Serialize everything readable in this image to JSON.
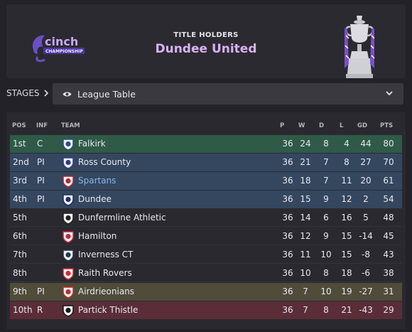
{
  "header": {
    "competition_logo_text": "cinch",
    "competition_logo_sub": "CHAMPIONSHIP",
    "holders_label": "TITLE HOLDERS",
    "holders_name": "Dundee United"
  },
  "stages": {
    "label": "STAGES",
    "selected": "League Table"
  },
  "table": {
    "columns": [
      "POS",
      "INF",
      "TEAM",
      "P",
      "W",
      "D",
      "L",
      "GD",
      "PTS"
    ],
    "rows": [
      {
        "pos": "1st",
        "inf": "C",
        "team": "Falkirk",
        "p": "36",
        "w": "24",
        "d": "8",
        "l": "4",
        "gd": "44",
        "pts": "80",
        "zone": "pro",
        "badge_color": "#2c4f8a"
      },
      {
        "pos": "2nd",
        "inf": "PI",
        "team": "Ross County",
        "p": "36",
        "w": "21",
        "d": "7",
        "l": "8",
        "gd": "27",
        "pts": "70",
        "zone": "playoff",
        "badge_color": "#2a3f88"
      },
      {
        "pos": "3rd",
        "inf": "PI",
        "team": "Spartans",
        "p": "36",
        "w": "18",
        "d": "7",
        "l": "11",
        "gd": "20",
        "pts": "61",
        "zone": "playoff",
        "badge_color": "#b02a35"
      },
      {
        "pos": "4th",
        "inf": "PI",
        "team": "Dundee",
        "p": "36",
        "w": "15",
        "d": "9",
        "l": "12",
        "gd": "2",
        "pts": "54",
        "zone": "playoff",
        "badge_color": "#1d2d6b"
      },
      {
        "pos": "5th",
        "inf": "",
        "team": "Dunfermline Athletic",
        "p": "36",
        "w": "14",
        "d": "6",
        "l": "16",
        "gd": "5",
        "pts": "48",
        "zone": "plain",
        "badge_color": "#222222"
      },
      {
        "pos": "6th",
        "inf": "",
        "team": "Hamilton",
        "p": "36",
        "w": "12",
        "d": "9",
        "l": "15",
        "gd": "-14",
        "pts": "45",
        "zone": "plain",
        "badge_color": "#c8283a"
      },
      {
        "pos": "7th",
        "inf": "",
        "team": "Inverness CT",
        "p": "36",
        "w": "11",
        "d": "10",
        "l": "15",
        "gd": "-8",
        "pts": "43",
        "zone": "plain",
        "badge_color": "#26365e"
      },
      {
        "pos": "8th",
        "inf": "",
        "team": "Raith Rovers",
        "p": "36",
        "w": "10",
        "d": "8",
        "l": "18",
        "gd": "-6",
        "pts": "38",
        "zone": "plain",
        "badge_color": "#d42a2a"
      },
      {
        "pos": "9th",
        "inf": "PI",
        "team": "Airdrieonians",
        "p": "36",
        "w": "7",
        "d": "10",
        "l": "19",
        "gd": "-27",
        "pts": "31",
        "zone": "rel-po",
        "badge_color": "#c42a2a"
      },
      {
        "pos": "10th",
        "inf": "R",
        "team": "Partick Thistle",
        "p": "36",
        "w": "7",
        "d": "8",
        "l": "21",
        "gd": "-43",
        "pts": "29",
        "zone": "rel",
        "badge_color": "#1a1a1a"
      }
    ]
  },
  "colors": {
    "promotion": "#2f5a48",
    "playoff": "#34475f",
    "relegation_playoff": "#4f4c3a",
    "relegation": "#5a2d38",
    "holders_accent": "#d9b2f2",
    "link": "#8eb4ea"
  }
}
